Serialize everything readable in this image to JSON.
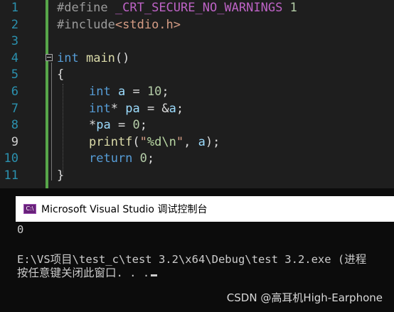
{
  "editor": {
    "line_numbers": [
      "1",
      "2",
      "3",
      "4",
      "5",
      "6",
      "7",
      "8",
      "9",
      "10",
      "11"
    ],
    "active_line": "9",
    "lines": {
      "l1": {
        "directive": "#define",
        "macro": "_CRT_SECURE_NO_WARNINGS",
        "value": "1"
      },
      "l2": {
        "directive": "#include",
        "header": "<stdio.h>"
      },
      "l4": {
        "type": "int",
        "name": "main",
        "parens": "()"
      },
      "l5": {
        "brace": "{"
      },
      "l6": {
        "type": "int",
        "var": "a",
        "op": " = ",
        "value": "10",
        "end": ";"
      },
      "l7": {
        "type": "int",
        "star": "*",
        "var": "pa",
        "op": " = &",
        "ref": "a",
        "end": ";"
      },
      "l8": {
        "star": "*",
        "var": "pa",
        "op": " = ",
        "value": "0",
        "end": ";"
      },
      "l9": {
        "fn": "printf",
        "open": "(",
        "str_open": "\"",
        "fmt": "%d\\n",
        "str_close": "\"",
        "sep": ", ",
        "arg": "a",
        "close": ");"
      },
      "l10": {
        "kw": "return",
        "value": "0",
        "end": ";"
      },
      "l11": {
        "brace": "}"
      }
    }
  },
  "console": {
    "icon_label": "C:\\",
    "title": "Microsoft Visual Studio 调试控制台",
    "output_line1": "0",
    "output_line2": "E:\\VS项目\\test_c\\test 3.2\\x64\\Debug\\test 3.2.exe (进程",
    "output_line3": "按任意键关闭此窗口. . ."
  },
  "watermark": "CSDN @高耳机High-Earphone",
  "colors": {
    "editor_bg": "#1e1e1e",
    "line_number": "#2b91af",
    "keyword": "#569cd6",
    "macro": "#bd63c5",
    "function": "#dcdcaa",
    "string": "#d69d85",
    "change_bar": "#57a64a",
    "console_bg": "#0c0c0c"
  }
}
